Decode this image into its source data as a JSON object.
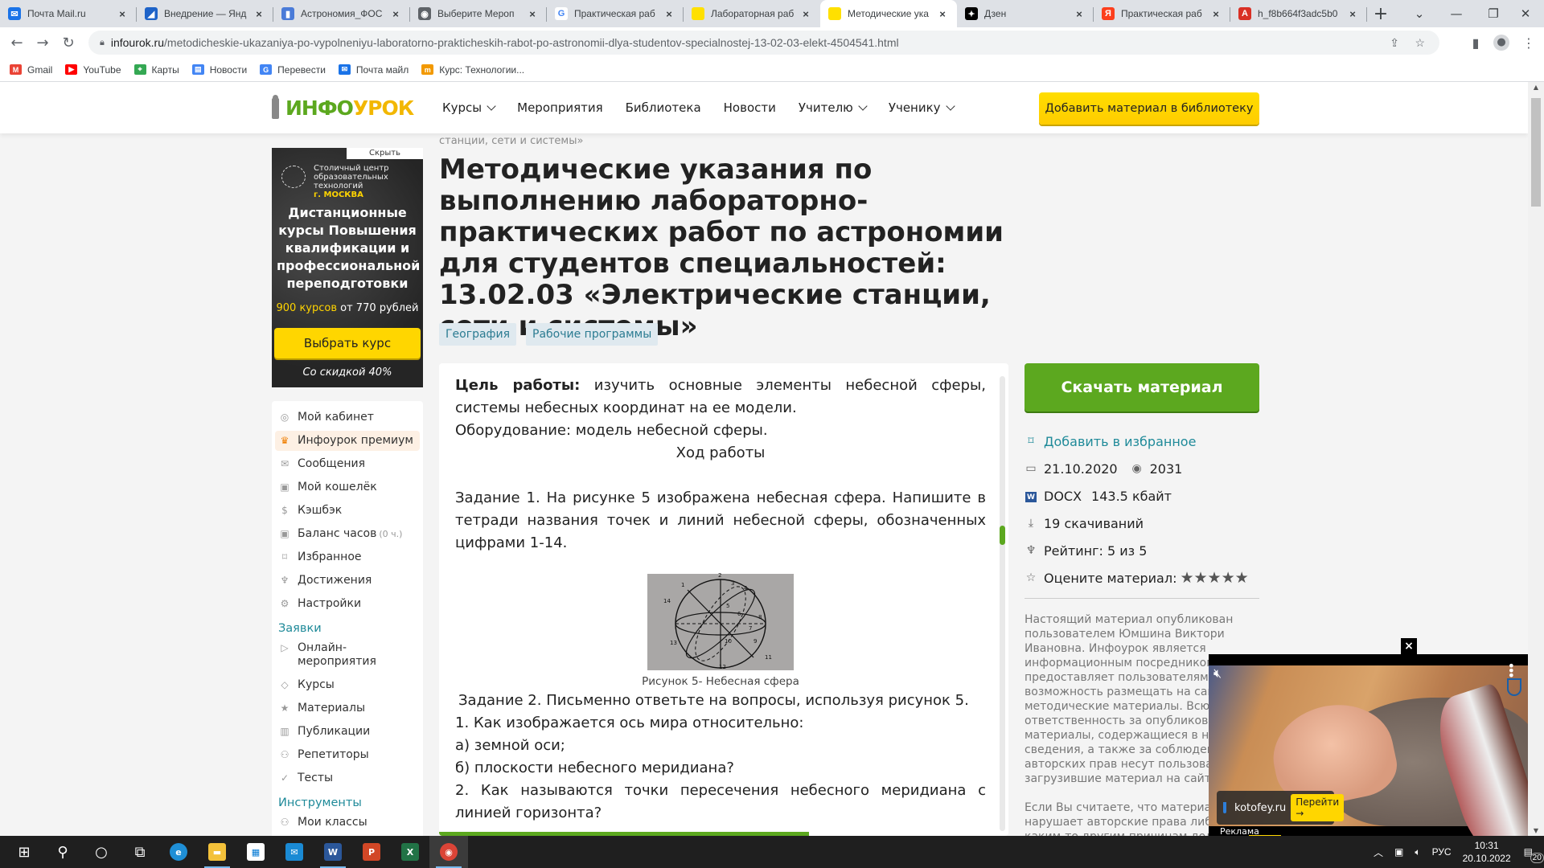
{
  "browser": {
    "tabs": [
      {
        "label": "Почта Mail.ru",
        "icon": "mail-ru-icon",
        "color": "#1a73e8",
        "glyph": "✉",
        "active": false
      },
      {
        "label": "Внедрение — Янд",
        "icon": "yandex-wave-icon",
        "color": "#1e63c8",
        "glyph": "◢",
        "active": false
      },
      {
        "label": "Астрономия_ФОС",
        "icon": "google-docs-icon",
        "color": "#4a7bd8",
        "glyph": "▮",
        "active": false
      },
      {
        "label": "Выберите Мероп",
        "icon": "globe-icon",
        "color": "#5f6368",
        "glyph": "◉",
        "active": false
      },
      {
        "label": "Практическая раб",
        "icon": "google-icon",
        "color": "#ffffff",
        "glyph": "G",
        "active": false
      },
      {
        "label": "Лабораторная раб",
        "icon": "infourok-tab-icon",
        "color": "#ffe000",
        "glyph": "",
        "active": false
      },
      {
        "label": "Методические ука",
        "icon": "infourok-tab-icon",
        "color": "#ffe000",
        "glyph": "",
        "active": true
      },
      {
        "label": "Дзен",
        "icon": "dzen-icon",
        "color": "#000000",
        "glyph": "✦",
        "active": false
      },
      {
        "label": "Практическая раб",
        "icon": "yandex-icon",
        "color": "#fc3f1d",
        "glyph": "Я",
        "active": false
      },
      {
        "label": "h_f8b664f3adc5b0",
        "icon": "pdf-icon",
        "color": "#d93025",
        "glyph": "A",
        "active": false
      }
    ],
    "url_host": "infourok.ru",
    "url_path": "/metodicheskie-ukazaniya-po-vypolneniyu-laboratorno-prakticheskih-rabot-po-astronomii-dlya-studentov-specialnostej-13-02-03-elekt-4504541.html",
    "bookmarks": [
      {
        "label": "Gmail",
        "icon": "gmail-icon",
        "color": "#ea4335",
        "glyph": "M"
      },
      {
        "label": "YouTube",
        "icon": "youtube-icon",
        "color": "#ff0000",
        "glyph": "▶"
      },
      {
        "label": "Карты",
        "icon": "maps-icon",
        "color": "#34a853",
        "glyph": "⌖"
      },
      {
        "label": "Новости",
        "icon": "news-icon",
        "color": "#4285f4",
        "glyph": "▤"
      },
      {
        "label": "Перевести",
        "icon": "translate-icon",
        "color": "#4285f4",
        "glyph": "G"
      },
      {
        "label": "Почта майл",
        "icon": "mail-ru-icon",
        "color": "#1a73e8",
        "glyph": "✉"
      },
      {
        "label": "Курс: Технологии...",
        "icon": "course-icon",
        "color": "#f29900",
        "glyph": "m"
      }
    ]
  },
  "site": {
    "logo_part1": "ИНФО",
    "logo_part2": "УРОК",
    "nav": [
      {
        "label": "Курсы",
        "dropdown": true
      },
      {
        "label": "Мероприятия",
        "dropdown": false
      },
      {
        "label": "Библиотека",
        "dropdown": false
      },
      {
        "label": "Новости",
        "dropdown": false
      },
      {
        "label": "Учителю",
        "dropdown": true
      },
      {
        "label": "Ученику",
        "dropdown": true
      }
    ],
    "add_material_button": "Добавить материал в библиотеку",
    "brand_green": "#5ca81f",
    "brand_yellow": "#ffd600"
  },
  "breadcrumb_tail": "станции, сети и системы»",
  "ad": {
    "hide_label": "Скрыть",
    "org_line1": "Столичный центр",
    "org_line2": "образовательных",
    "org_line3": "технологий",
    "city": "г. МОСКВА",
    "headline": "Дистанционные курсы Повышения квалификации и профессиональной переподготовки",
    "price_highlight": "900 курсов",
    "price_rest": " от 770 рублей",
    "button": "Выбрать курс",
    "discount": "Со скидкой 40%"
  },
  "side_menu": {
    "items": [
      {
        "label": "Мой кабинет",
        "icon": "user-circle-icon",
        "glyph": "◎"
      },
      {
        "label": "Инфоурок премиум",
        "icon": "crown-icon",
        "glyph": "♛",
        "highlight": true
      },
      {
        "label": "Сообщения",
        "icon": "envelope-icon",
        "glyph": "✉"
      },
      {
        "label": "Мой кошелёк",
        "icon": "wallet-icon",
        "glyph": "▣"
      },
      {
        "label": "Кэшбэк",
        "icon": "dollar-circle-icon",
        "glyph": "$"
      },
      {
        "label": "Баланс часов",
        "suffix": "(0 ч.)",
        "icon": "wallet-icon",
        "glyph": "▣"
      },
      {
        "label": "Избранное",
        "icon": "bookmark-icon",
        "glyph": "⌑"
      },
      {
        "label": "Достижения",
        "icon": "trophy-icon",
        "glyph": "♆"
      },
      {
        "label": "Настройки",
        "icon": "gear-icon",
        "glyph": "⚙"
      }
    ],
    "section_requests": "Заявки",
    "requests": [
      {
        "label": "Онлайн-мероприятия",
        "icon": "play-screen-icon",
        "glyph": "▷"
      },
      {
        "label": "Курсы",
        "icon": "graduation-cap-icon",
        "glyph": "◇"
      },
      {
        "label": "Материалы",
        "icon": "star-icon",
        "glyph": "★"
      },
      {
        "label": "Публикации",
        "icon": "book-icon",
        "glyph": "▥"
      },
      {
        "label": "Репетиторы",
        "icon": "people-icon",
        "glyph": "⚇"
      },
      {
        "label": "Тесты",
        "icon": "check-circle-icon",
        "glyph": "✓"
      }
    ],
    "section_tools": "Инструменты",
    "tools": [
      {
        "label": "Мои классы",
        "icon": "classes-icon",
        "glyph": "⚇"
      }
    ]
  },
  "material": {
    "title": "Методические указания по выполнению лабораторно-практических работ по астрономии для студентов специальностей: 13.02.03 «Электрические станции, сети и системы»",
    "tags": [
      "География",
      "Рабочие программы"
    ],
    "goal_label": "Цель работы:",
    "goal_text": " изучить основные элементы небесной сферы, системы небесных координат на ее модели.",
    "equipment": "Оборудование: модель небесной сферы.",
    "progress_heading": "Ход работы",
    "task1": "Задание 1. На рисунке 5 изображена небесная сфера. Напишите в тетради названия точек и линий небесной сферы, обозначенных цифрами 1-14.",
    "figure_caption": "Рисунок 5- Небесная сфера",
    "figure_labels": [
      "1",
      "2",
      "3",
      "4",
      "5",
      "6",
      "7",
      "8",
      "9",
      "10",
      "11",
      "12",
      "13",
      "14"
    ],
    "task2": "Задание 2. Письменно ответьте на вопросы, используя рисунок 5.",
    "q1": "1. Как изображается ось мира относительно:",
    "q1a": "а) земной оси;",
    "q1b": "б) плоскости небесного меридиана?",
    "q2": "2. Как называются точки пересечения небесного меридиана с линией горизонта?"
  },
  "sidebar_right": {
    "download_button": "Скачать материал",
    "add_favorite": "Добавить в избранное",
    "date": "21.10.2020",
    "views": "2031",
    "file_type": "DOCX",
    "file_size": "143.5 кбайт",
    "downloads": "19 скачиваний",
    "rating": "Рейтинг: 5 из 5",
    "rate_label": "Оцените материал:",
    "rate_stars": 5,
    "legal_p1": "Настоящий материал опубликован пользователем Юмшина Виктори Ивановна. Инфоурок является информационным посредником и предоставляет пользователям возможность размещать на сайте методические материалы. Всю ответственность за опубликованные материалы, содержащиеся в них сведения, а также за соблюдение авторских прав несут пользователи, загрузившие материал на сайт",
    "legal_p2": "Если Вы считаете, что материал нарушает авторские права либо по каким-то другим причинам должен быть удален с"
  },
  "video_ad": {
    "site": "kotofey.ru",
    "go_button": "Перейти →",
    "label": "Реклама",
    "close": "×"
  },
  "taskbar": {
    "apps": [
      {
        "name": "start-button",
        "glyph": "⊞",
        "color": ""
      },
      {
        "name": "search-button",
        "glyph": "⚲",
        "color": ""
      },
      {
        "name": "cortana-button",
        "glyph": "○",
        "color": ""
      },
      {
        "name": "task-view-button",
        "glyph": "⧉",
        "color": ""
      },
      {
        "name": "edge-app",
        "glyph": "e",
        "color": "#1f8fd6"
      },
      {
        "name": "file-explorer-app",
        "glyph": "▬",
        "color": "#f3c13a"
      },
      {
        "name": "store-app",
        "glyph": "▦",
        "color": "#ffffff"
      },
      {
        "name": "mail-app",
        "glyph": "✉",
        "color": "#1a8ad4"
      },
      {
        "name": "word-app",
        "glyph": "W",
        "color": "#2b579a"
      },
      {
        "name": "powerpoint-app",
        "glyph": "P",
        "color": "#d24726"
      },
      {
        "name": "excel-app",
        "glyph": "X",
        "color": "#217346"
      },
      {
        "name": "chrome-app",
        "glyph": "◉",
        "color": "#db4437"
      }
    ],
    "language": "РУС",
    "time": "10:31",
    "date": "20.10.2022",
    "notifications": "20"
  }
}
